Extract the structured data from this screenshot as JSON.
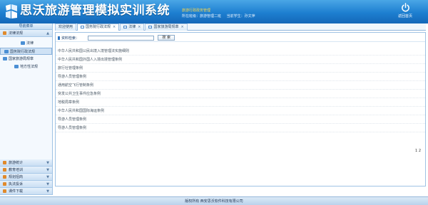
{
  "header": {
    "title": "思沃旅游管理模拟实训系统",
    "module_name": "旅游行政政务管理",
    "org_label": "所在班级：旅游管理二班",
    "user_label": "当前学生：孙文萍",
    "home_label": "返回首页"
  },
  "sidebar": {
    "header": "导航菜单",
    "category_open": "法律法规",
    "tree": [
      {
        "label": "法律",
        "level": "lvl1"
      },
      {
        "label": "国务院行政法规",
        "level": "lvl1b",
        "selected": true
      },
      {
        "label": "国家旅游局规章",
        "level": "lvl1c"
      },
      {
        "label": "地方性法规",
        "level": "lvl2"
      }
    ],
    "bottom_categories": [
      "旅游统计",
      "教育培训",
      "规划招商",
      "执法投诉",
      "课件下载"
    ]
  },
  "tabs": [
    {
      "label": "欢迎使用",
      "icon": false,
      "closable": false,
      "active": false
    },
    {
      "label": "国务院行政法规",
      "icon": true,
      "closable": true,
      "active": true
    },
    {
      "label": "法律",
      "icon": true,
      "closable": true,
      "active": false
    },
    {
      "label": "国家旅游局规章",
      "icon": true,
      "closable": true,
      "active": false
    }
  ],
  "search": {
    "label": "资料检索：",
    "value": "",
    "placeholder": "",
    "button": "搜 索"
  },
  "list_items": [
    "中华人民共和国公民出境入境管理法实施细则",
    "中华人民共和国外国人入境出境管理条例",
    "旅行社管理条例",
    "导游人员管理条例",
    "通用航空飞行管制条例",
    "突发公共卫生事件应急条例",
    "地税局章条例",
    "中华人民共和国国际海运条例",
    "导游人员管理条例",
    "导游人员管理条例"
  ],
  "pager": "1 2",
  "footer": "版权所有 西安思沃软件科技有限公司",
  "colors": {
    "header_top": "#4aa6e6",
    "header_bottom": "#1467b8",
    "module_name": "#ffd84a",
    "category_icon": "#e08a2c"
  },
  "icons": {
    "logo": "siwo-logo-icon",
    "home": "power-icon",
    "folder": "folder-icon",
    "tab": "tab-page-icon",
    "close": "close-icon",
    "expand": "chevron-icon"
  }
}
